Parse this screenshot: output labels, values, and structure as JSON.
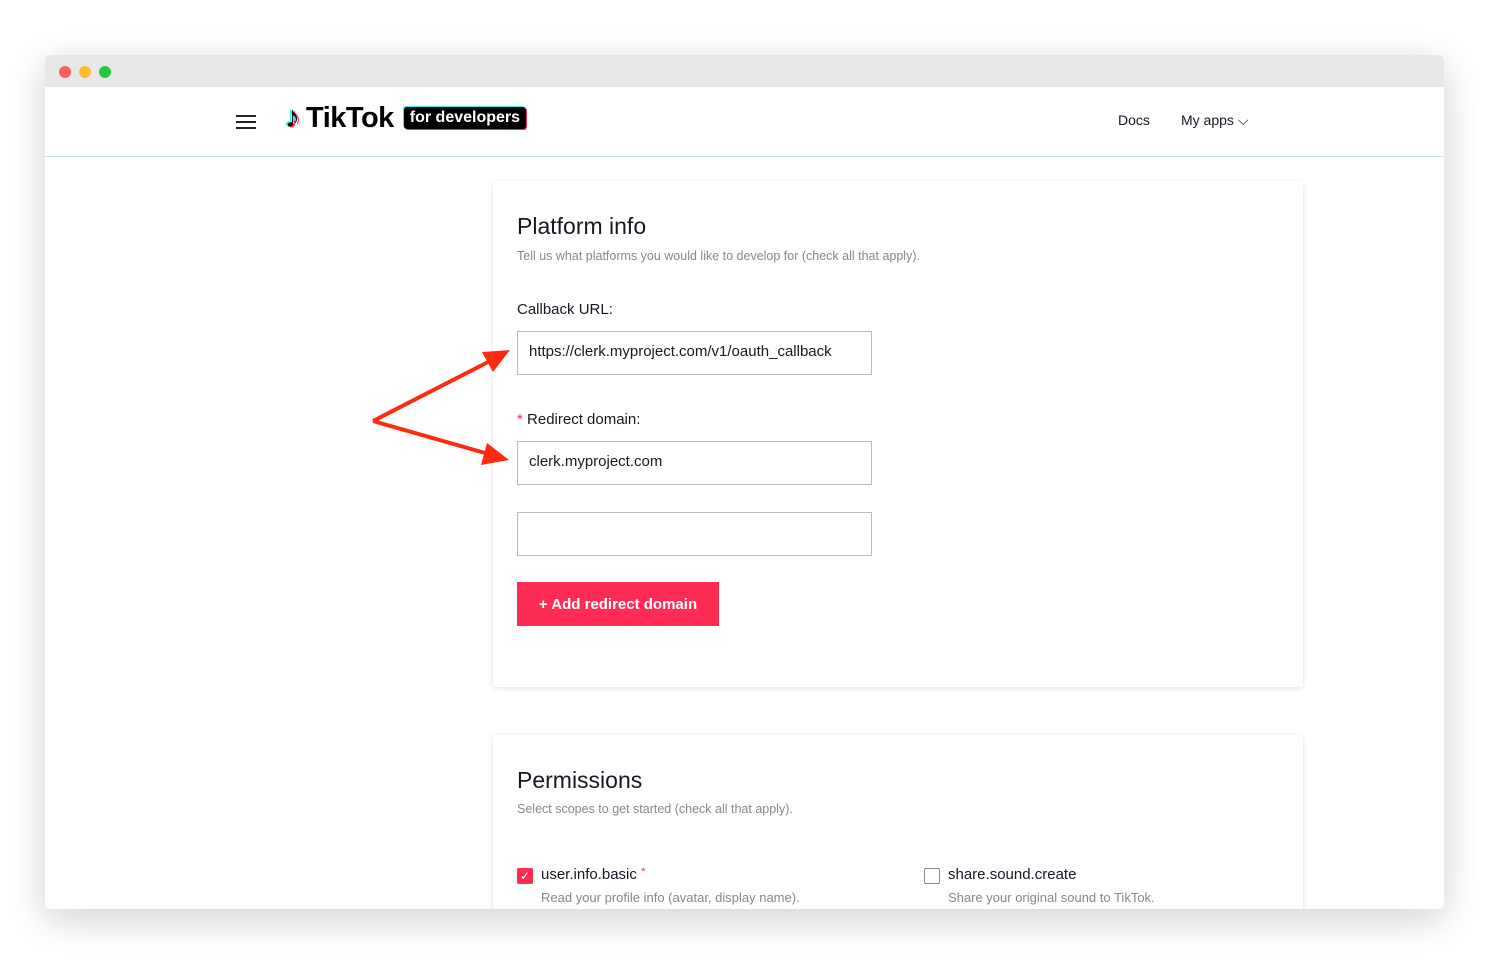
{
  "header": {
    "logo_text": "TikTok",
    "logo_badge": "for developers",
    "nav_docs": "Docs",
    "nav_my_apps": "My apps",
    "chevron": "⌵"
  },
  "platform": {
    "title": "Platform info",
    "subtitle": "Tell us what platforms you would like to develop for (check all that apply).",
    "callback_label": "Callback URL:",
    "callback_value": "https://clerk.myproject.com/v1/oauth_callback",
    "required_mark": "*",
    "redirect_label": "Redirect domain:",
    "redirect_value": "clerk.myproject.com",
    "redirect_value_2": "",
    "add_button": "+ Add redirect domain"
  },
  "permissions": {
    "title": "Permissions",
    "subtitle": "Select scopes to get started (check all that apply).",
    "scopes": [
      {
        "name": "user.info.basic",
        "required": "*",
        "description": "Read your profile info (avatar, display name).",
        "checked": true
      },
      {
        "name": "share.sound.create",
        "description": "Share your original sound to TikTok.",
        "checked": false
      }
    ]
  },
  "colors": {
    "accent": "#fe2c55",
    "arrow": "#ff2a10"
  }
}
